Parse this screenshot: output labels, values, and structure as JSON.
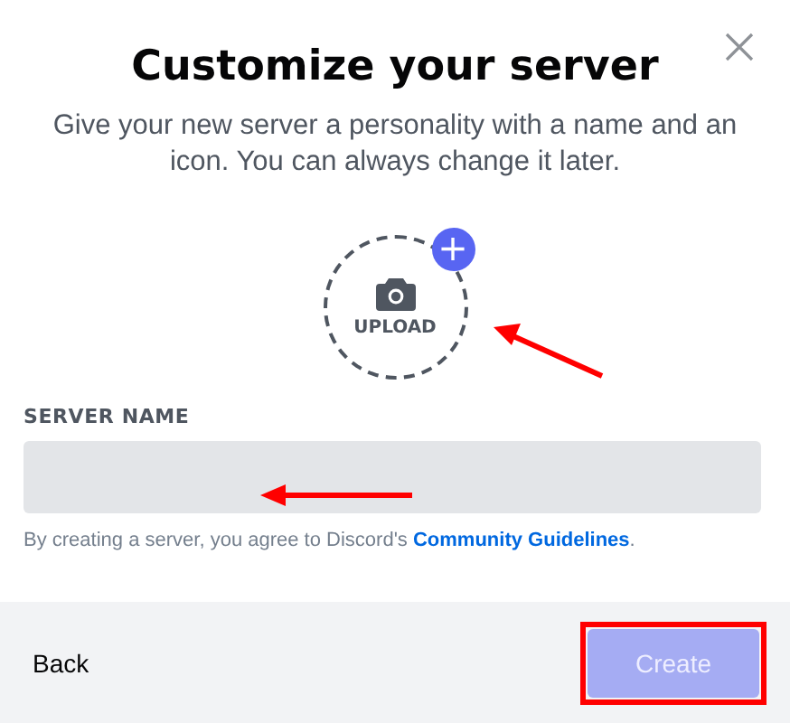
{
  "title": "Customize your server",
  "subtitle": "Give your new server a personality with a name and an icon. You can always change it later.",
  "upload": {
    "label": "UPLOAD",
    "plus": "+",
    "annotated": true
  },
  "server_name": {
    "label": "SERVER NAME",
    "annotated": true
  },
  "note": "By creating a server, you agree to Discord's **Community Guidelines**.",
  "footer": {
    "back": "Back",
    "create_button": {
      "label": "Create",
      "disabled": true,
      "highlighted": true
    }
  }
}
